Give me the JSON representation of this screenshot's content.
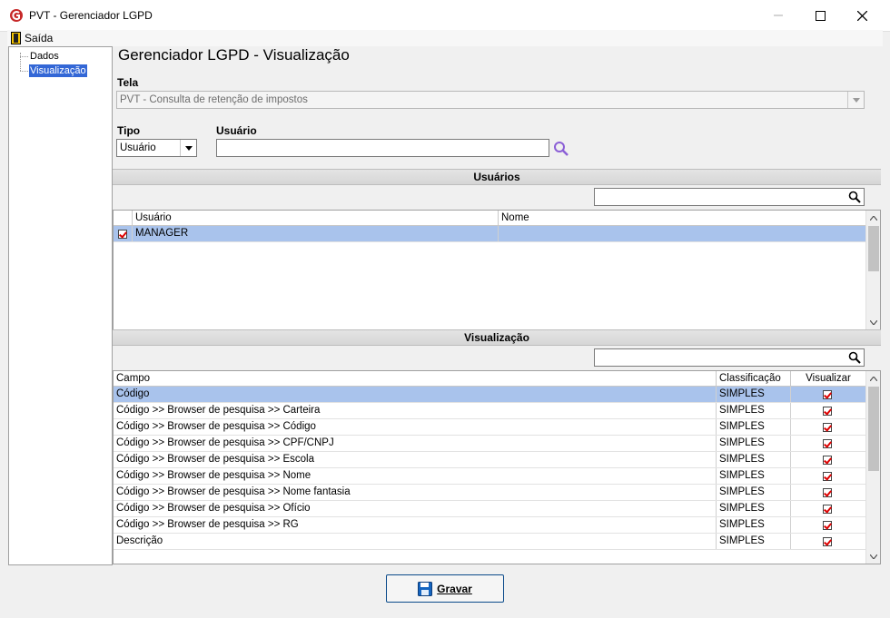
{
  "window": {
    "title": "PVT - Gerenciador LGPD"
  },
  "menu": {
    "exit_label": "Saída"
  },
  "tree": {
    "items": [
      {
        "label": "Dados"
      },
      {
        "label": "Visualização"
      }
    ]
  },
  "main": {
    "heading": "Gerenciador LGPD - Visualização",
    "tela_label": "Tela",
    "tela_value": "PVT - Consulta de retenção de impostos",
    "tipo_label": "Tipo",
    "tipo_value": "Usuário",
    "usuario_label": "Usuário",
    "usuario_value": ""
  },
  "users_section": {
    "title": "Usuários",
    "search_value": "",
    "columns": [
      "Usuário",
      "Nome"
    ],
    "rows": [
      {
        "checked": true,
        "usuario": "MANAGER",
        "nome": ""
      }
    ]
  },
  "view_section": {
    "title": "Visualização",
    "search_value": "",
    "columns": [
      "Campo",
      "Classificação",
      "Visualizar"
    ],
    "rows": [
      {
        "campo": "Código",
        "classificacao": "SIMPLES",
        "visualizar": true
      },
      {
        "campo": "Código >> Browser de pesquisa >> Carteira",
        "classificacao": "SIMPLES",
        "visualizar": true
      },
      {
        "campo": "Código >> Browser de pesquisa >> Código",
        "classificacao": "SIMPLES",
        "visualizar": true
      },
      {
        "campo": "Código >> Browser de pesquisa >> CPF/CNPJ",
        "classificacao": "SIMPLES",
        "visualizar": true
      },
      {
        "campo": "Código >> Browser de pesquisa >> Escola",
        "classificacao": "SIMPLES",
        "visualizar": true
      },
      {
        "campo": "Código >> Browser de pesquisa >> Nome",
        "classificacao": "SIMPLES",
        "visualizar": true
      },
      {
        "campo": "Código >> Browser de pesquisa >> Nome fantasia",
        "classificacao": "SIMPLES",
        "visualizar": true
      },
      {
        "campo": "Código >> Browser de pesquisa >> Ofício",
        "classificacao": "SIMPLES",
        "visualizar": true
      },
      {
        "campo": "Código >> Browser de pesquisa >> RG",
        "classificacao": "SIMPLES",
        "visualizar": true
      },
      {
        "campo": "Descrição",
        "classificacao": "SIMPLES",
        "visualizar": true
      }
    ]
  },
  "footer": {
    "save_label": "Gravar"
  },
  "colors": {
    "selection": "#a9c3ec",
    "tree_selection": "#3367d6",
    "accent": "#0a4a8a",
    "check": "#dd0000"
  }
}
